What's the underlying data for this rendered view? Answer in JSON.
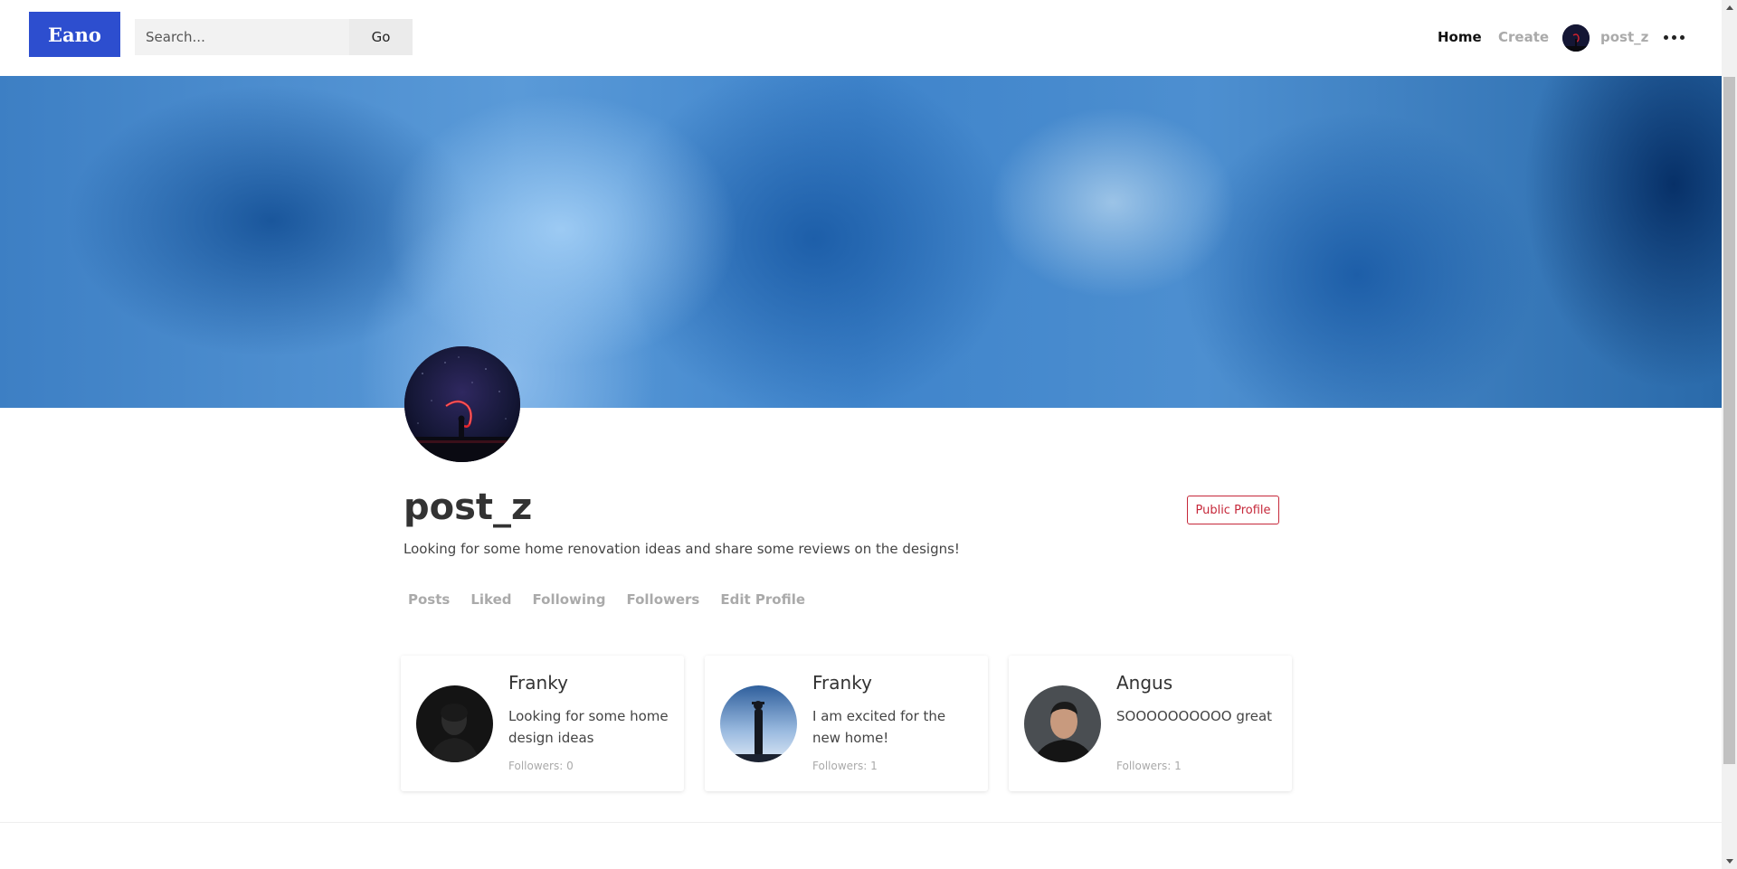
{
  "header": {
    "logo_text": "Eano",
    "search_placeholder": "Search...",
    "go_label": "Go",
    "nav": {
      "home": "Home",
      "create": "Create",
      "username": "post_z"
    },
    "more_icon": "more-horizontal-icon"
  },
  "profile": {
    "name": "post_z",
    "bio": "Looking for some home renovation ideas and share some reviews on the designs!",
    "public_profile_label": "Public Profile",
    "tabs": [
      "Posts",
      "Liked",
      "Following",
      "Followers",
      "Edit Profile"
    ]
  },
  "cards": [
    {
      "name": "Franky",
      "description": "Looking for some home design ideas",
      "followers": "Followers: 0"
    },
    {
      "name": "Franky",
      "description": "I am excited for the new home!",
      "followers": "Followers: 1"
    },
    {
      "name": "Angus",
      "description": "SOOOOOOOOOO great",
      "followers": "Followers: 1"
    }
  ],
  "colors": {
    "brand": "#2d4ecf",
    "public_profile": "#c6283a",
    "inactive_nav": "#aaaaaa"
  }
}
